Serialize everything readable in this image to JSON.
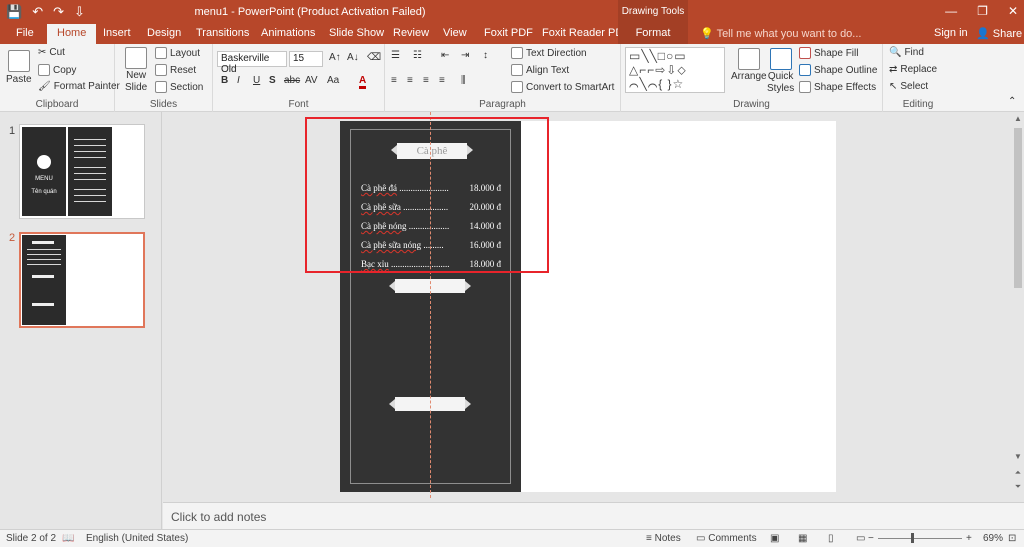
{
  "window": {
    "title": "menu1 - PowerPoint (Product Activation Failed)",
    "context_label": "Drawing Tools",
    "minimize": "—",
    "restore": "❐",
    "close": "✕"
  },
  "qat": {
    "save": "💾",
    "undo": "↶",
    "redo": "↷",
    "more": "⇩"
  },
  "tabs": {
    "file": "File",
    "home": "Home",
    "insert": "Insert",
    "design": "Design",
    "transitions": "Transitions",
    "animations": "Animations",
    "slideshow": "Slide Show",
    "review": "Review",
    "view": "View",
    "foxit": "Foxit PDF",
    "foxit_reader": "Foxit Reader PDF",
    "format": "Format"
  },
  "tell_me": "Tell me what you want to do...",
  "sign_in": "Sign in",
  "share": "Share",
  "ribbon": {
    "clipboard": {
      "label": "Clipboard",
      "paste": "Paste",
      "cut": "Cut",
      "copy": "Copy",
      "format_painter": "Format Painter"
    },
    "slides": {
      "label": "Slides",
      "new_slide": "New",
      "new_slide2": "Slide",
      "layout": "Layout",
      "reset": "Reset",
      "section": "Section"
    },
    "font": {
      "label": "Font",
      "family": "Baskerville Old",
      "size": "15",
      "bold": "B",
      "italic": "I",
      "underline": "U",
      "shadow": "S",
      "strike": "abc",
      "spacing": "AV",
      "case": "Aa",
      "color": "A"
    },
    "paragraph": {
      "label": "Paragraph",
      "text_direction": "Text Direction",
      "align_text": "Align Text",
      "smartart": "Convert to SmartArt"
    },
    "drawing": {
      "label": "Drawing",
      "arrange": "Arrange",
      "quick": "Quick",
      "styles": "Styles",
      "shape_fill": "Shape Fill",
      "shape_outline": "Shape Outline",
      "shape_effects": "Shape Effects",
      "shapes_glyphs": "▭╲╲□○▭ △⌐⌐⇨⇩⬦ ⌒╲⌒{ }☆"
    },
    "editing": {
      "label": "Editing",
      "find": "Find",
      "replace": "Replace",
      "select": "Select"
    }
  },
  "thumbnails": {
    "slide1_num": "1",
    "slide2_num": "2",
    "slide1_menu": "MENU",
    "slide1_shop": "Tên quán"
  },
  "slide": {
    "banner_title": "Cà phê",
    "items": [
      {
        "name": "Cà phê đá",
        "dots": " ......................",
        "price": "18.000 đ"
      },
      {
        "name": "Cà phê sữa",
        "dots": " ....................",
        "price": "20.000 đ"
      },
      {
        "name": "Cà phê nóng",
        "dots": " ..................",
        "price": "14.000 đ"
      },
      {
        "name": "Cà phê sữa nóng",
        "dots": " .........",
        "price": "16.000 đ"
      },
      {
        "name": "Bạc xỉu",
        "dots": " ..........................",
        "price": "18.000 đ"
      }
    ]
  },
  "notes_placeholder": "Click to add notes",
  "status": {
    "slide": "Slide 2 of 2",
    "language": "English (United States)",
    "notes": "Notes",
    "comments": "Comments",
    "zoom": "69%",
    "zoom_minus": "−",
    "zoom_plus": "+"
  },
  "colors": {
    "accent": "#b7472a",
    "selection": "#e8242b",
    "chalkboard": "#333333"
  }
}
